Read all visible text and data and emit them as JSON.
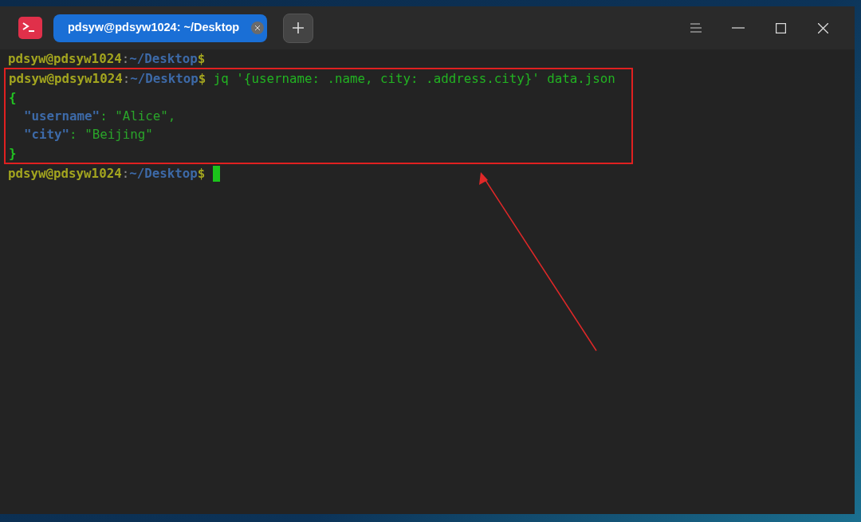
{
  "window": {
    "tab": {
      "title": "pdsyw@pdsyw1024: ~/Desktop",
      "selected": true
    }
  },
  "terminal": {
    "cursor": true,
    "blocks": [
      {
        "highlighted": false,
        "lines": [
          {
            "segments": [
              {
                "kind": "user",
                "text": "pdsyw@pdsyw1024"
              },
              {
                "kind": "sep",
                "text": ":"
              },
              {
                "kind": "path",
                "text": "~/Desktop"
              },
              {
                "kind": "user",
                "text": "$"
              }
            ]
          }
        ]
      },
      {
        "highlighted": true,
        "lines": [
          {
            "segments": [
              {
                "kind": "user",
                "text": "pdsyw@pdsyw1024"
              },
              {
                "kind": "sep",
                "text": ":"
              },
              {
                "kind": "path",
                "text": "~/Desktop"
              },
              {
                "kind": "user",
                "text": "$"
              },
              {
                "kind": "command",
                "text": " jq '{username: .name, city: .address.city}' data.json"
              }
            ]
          },
          {
            "segments": [
              {
                "kind": "brace",
                "text": "{"
              }
            ]
          },
          {
            "segments": [
              {
                "kind": "key",
                "text": "  \"username\""
              },
              {
                "kind": "punct",
                "text": ": "
              },
              {
                "kind": "string",
                "text": "\"Alice\""
              },
              {
                "kind": "punct",
                "text": ","
              }
            ]
          },
          {
            "segments": [
              {
                "kind": "key",
                "text": "  \"city\""
              },
              {
                "kind": "punct",
                "text": ": "
              },
              {
                "kind": "string",
                "text": "\"Beijing\""
              }
            ]
          },
          {
            "segments": [
              {
                "kind": "brace",
                "text": "}"
              }
            ]
          }
        ]
      },
      {
        "highlighted": false,
        "lines": [
          {
            "segments": [
              {
                "kind": "user",
                "text": "pdsyw@pdsyw1024"
              },
              {
                "kind": "sep",
                "text": ":"
              },
              {
                "kind": "path",
                "text": "~/Desktop"
              },
              {
                "kind": "user",
                "text": "$"
              }
            ]
          }
        ]
      }
    ]
  },
  "annotations": [
    {
      "kind": "arrow"
    }
  ]
}
